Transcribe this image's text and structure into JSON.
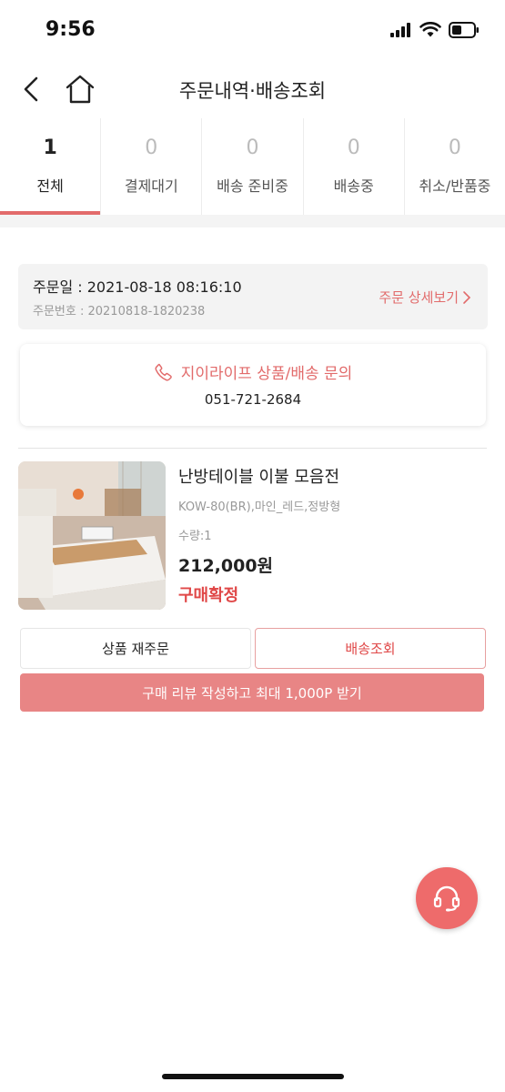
{
  "status_bar": {
    "time": "9:56"
  },
  "nav": {
    "title": "주문내역·배송조회"
  },
  "tabs": [
    {
      "count": "1",
      "label": "전체",
      "active": true
    },
    {
      "count": "0",
      "label": "결제대기"
    },
    {
      "count": "0",
      "label": "배송 준비중"
    },
    {
      "count": "0",
      "label": "배송중"
    },
    {
      "count": "0",
      "label": "취소/반품중"
    }
  ],
  "order": {
    "date": "주문일 : 2021-08-18 08:16:10",
    "number": "주문번호 : 20210818-1820238",
    "detail_link": "주문 상세보기"
  },
  "inquiry": {
    "title": "지이라이프 상품/배송 문의",
    "phone": "051-721-2684"
  },
  "product": {
    "name": "난방테이블 이불 모음전",
    "option": "KOW-80(BR),마인_레드,정방형",
    "quantity": "수량:1",
    "price": "212,000원",
    "status": "구매확정"
  },
  "buttons": {
    "reorder": "상품 재주문",
    "track": "배송조회",
    "review": "구매 리뷰 작성하고 최대 1,000P 받기"
  },
  "icons": {
    "back": "chevron-left-icon",
    "home": "home-icon",
    "phone": "phone-icon",
    "chevron": "chevron-right-icon",
    "support": "headset-icon"
  },
  "colors": {
    "accent": "#e26b6b",
    "status_red": "#e04848",
    "review_button": "#e88585",
    "fab": "#ee6b6b"
  }
}
